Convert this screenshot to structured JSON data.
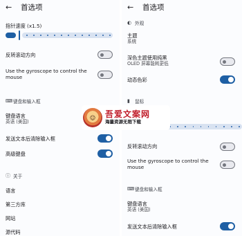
{
  "left": {
    "title": "首选项",
    "pointer_speed_label": "指针速度 (x1.5)",
    "pointer_speed_fraction": 0.1,
    "reverse_scroll_label": "反转滚动方向",
    "reverse_scroll_on": false,
    "gyroscope_label": "Use the gyroscope to control the mouse",
    "gyroscope_on": false,
    "keyboard_section": "键盘和输入框",
    "keyboard_language_label": "键盘语言",
    "keyboard_language_value": "英语 (美国)",
    "clear_after_send_label": "发送文本后清除输入框",
    "clear_after_send_on": true,
    "advanced_keyboard_label": "高级键盘",
    "advanced_keyboard_on": true,
    "about_section": "关于",
    "language_label": "语言",
    "third_party_label": "第三方库",
    "website_label": "网站",
    "source_code_label": "源代码"
  },
  "right": {
    "title": "首选项",
    "appearance_section": "外观",
    "theme_label": "主题",
    "theme_value": "系统",
    "dark_pure_black_label": "深色主题使用纯黑",
    "dark_pure_black_sub": "OLED 屏幕能耗更低",
    "dark_pure_black_on": false,
    "dynamic_color_label": "动态色彩",
    "dynamic_color_on": true,
    "mouse_section": "鼠标",
    "pointer_speed_label": "指针速度 (x1.5)",
    "reverse_scroll_label": "反转滚动方向",
    "reverse_scroll_on": false,
    "gyroscope_label": "Use the gyroscope to control the mouse",
    "gyroscope_on": false,
    "keyboard_section": "键盘和输入框",
    "keyboard_language_label": "键盘语言",
    "keyboard_language_value": "英语 (美国)",
    "clear_after_send_label": "发送文本后清除输入框",
    "clear_after_send_on": true
  },
  "watermark": {
    "title": "吾爱文案网",
    "subtitle": "海量资源无限下载"
  },
  "colors": {
    "accent": "#1e5fa4",
    "toggle_off_border": "#74777f"
  },
  "icons": {
    "back": "arrow-left",
    "appearance": "palette",
    "mouse": "mouse",
    "keyboard": "keyboard",
    "about": "info-circle"
  }
}
